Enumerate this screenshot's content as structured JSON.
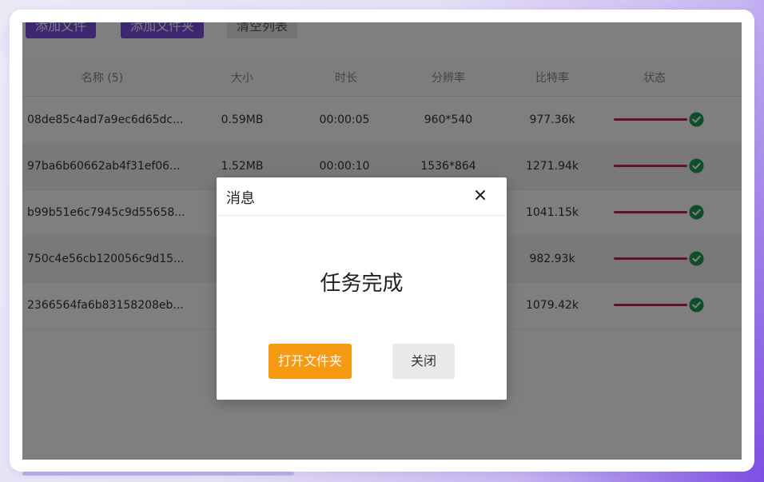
{
  "toolbar": {
    "add_file": "添加文件",
    "add_folder": "添加文件夹",
    "clear_list": "清空列表"
  },
  "table": {
    "headers": {
      "name": "名称 (5)",
      "size": "大小",
      "duration": "时长",
      "resolution": "分辨率",
      "bitrate": "比特率",
      "status": "状态"
    },
    "rows": [
      {
        "name": "08de85c4ad7a9ec6d65dc...",
        "size": "0.59MB",
        "duration": "00:00:05",
        "resolution": "960*540",
        "bitrate": "977.36k",
        "progress": 1.0
      },
      {
        "name": "97ba6b60662ab4f31ef06...",
        "size": "1.52MB",
        "duration": "00:00:10",
        "resolution": "1536*864",
        "bitrate": "1271.94k",
        "progress": 1.0
      },
      {
        "name": "b99b51e6c7945c9d55658...",
        "size": "",
        "duration": "",
        "resolution": "",
        "bitrate": "1041.15k",
        "progress": 1.0
      },
      {
        "name": "750c4e56cb120056c9d15...",
        "size": "",
        "duration": "",
        "resolution": "",
        "bitrate": "982.93k",
        "progress": 1.0
      },
      {
        "name": "2366564fa6b83158208eb...",
        "size": "",
        "duration": "",
        "resolution": "",
        "bitrate": "1079.42k",
        "progress": 1.0
      }
    ]
  },
  "dialog": {
    "title": "消息",
    "message": "任务完成",
    "open_folder": "打开文件夹",
    "close": "关闭"
  },
  "colors": {
    "accent_purple": "#7b4fe0",
    "progress": "#c5235a",
    "success": "#1f9d55",
    "open_button": "#f79a13"
  },
  "icons": {
    "close": "close-icon",
    "status_done": "check-circle-icon"
  }
}
